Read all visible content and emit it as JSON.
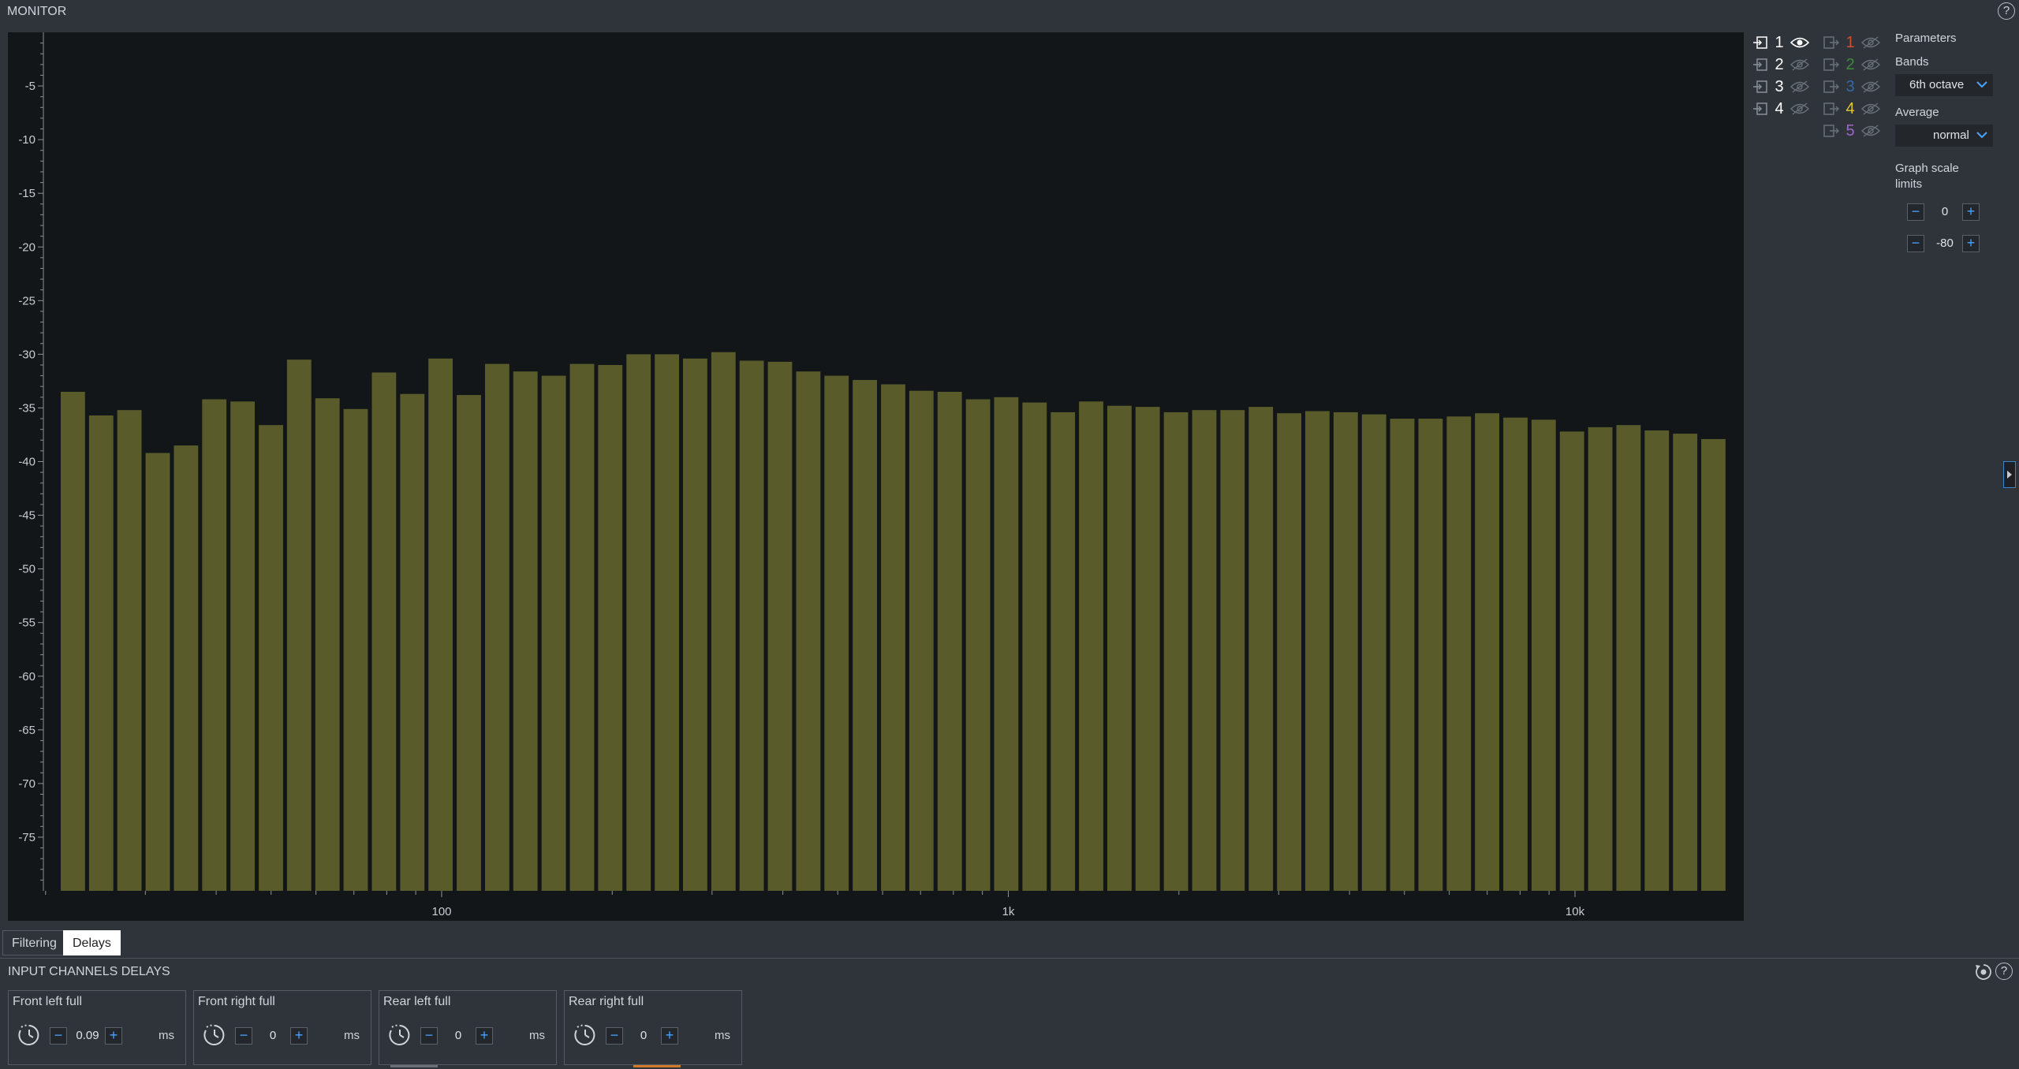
{
  "header": {
    "title": "MONITOR",
    "help_glyph": "?"
  },
  "chart_data": {
    "type": "bar",
    "title": "",
    "xlabel": "",
    "ylabel": "",
    "xscale": "log",
    "ylim": [
      -80,
      0
    ],
    "yticks": [
      -5,
      -10,
      -15,
      -20,
      -25,
      -30,
      -35,
      -40,
      -45,
      -50,
      -55,
      -60,
      -65,
      -70,
      -75
    ],
    "xticks": [
      {
        "value": 100,
        "label": "100"
      },
      {
        "value": 1000,
        "label": "1k"
      },
      {
        "value": 10000,
        "label": "10k"
      }
    ],
    "bar_color": "#595c2a",
    "series": [
      {
        "values": [
          -33.5,
          -35.7,
          -35.2,
          -39.2,
          -38.5,
          -34.2,
          -34.4,
          -36.6,
          -30.5,
          -34.1,
          -35.1,
          -31.7,
          -33.7,
          -30.4,
          -33.8,
          -30.9,
          -31.6,
          -32.0,
          -30.9,
          -31.0,
          -30.0,
          -30.0,
          -30.4,
          -29.8,
          -30.6,
          -30.7,
          -31.6,
          -32.0,
          -32.4,
          -32.8,
          -33.4,
          -33.5,
          -34.2,
          -34.0,
          -34.5,
          -35.4,
          -34.4,
          -34.8,
          -34.9,
          -35.4,
          -35.2,
          -35.2,
          -34.9,
          -35.5,
          -35.3,
          -35.4,
          -35.6,
          -36.0,
          -36.0,
          -35.8,
          -35.5,
          -35.9,
          -36.1,
          -37.2,
          -36.8,
          -36.6,
          -37.1,
          -37.4,
          -37.9
        ]
      }
    ]
  },
  "channels": {
    "inputs": [
      {
        "num": "1",
        "visible": true
      },
      {
        "num": "2",
        "visible": false
      },
      {
        "num": "3",
        "visible": false
      },
      {
        "num": "4",
        "visible": false
      }
    ],
    "outputs": [
      {
        "num": "1",
        "color": "#d9492f",
        "visible": false
      },
      {
        "num": "2",
        "color": "#3e8a3a",
        "visible": false
      },
      {
        "num": "3",
        "color": "#3469a9",
        "visible": false
      },
      {
        "num": "4",
        "color": "#e6c331",
        "visible": false
      },
      {
        "num": "5",
        "color": "#a064c8",
        "visible": false
      }
    ]
  },
  "parameters": {
    "title": "Parameters",
    "bands_label": "Bands",
    "bands_value": "6th octave",
    "average_label": "Average",
    "average_value": "normal",
    "scale_label_1": "Graph scale",
    "scale_label_2": "limits",
    "scale_max": "0",
    "scale_min": "-80"
  },
  "tabs": [
    {
      "label": "Filtering",
      "active": false
    },
    {
      "label": "Delays",
      "active": true
    }
  ],
  "delays": {
    "section_title": "INPUT CHANNELS DELAYS",
    "unit": "ms",
    "cards": [
      {
        "name": "Front left full",
        "value": "0.09"
      },
      {
        "name": "Front right full",
        "value": "0"
      },
      {
        "name": "Rear left full",
        "value": "0"
      },
      {
        "name": "Rear right full",
        "value": "0"
      }
    ]
  },
  "stepper_glyphs": {
    "minus": "−",
    "plus": "+"
  }
}
